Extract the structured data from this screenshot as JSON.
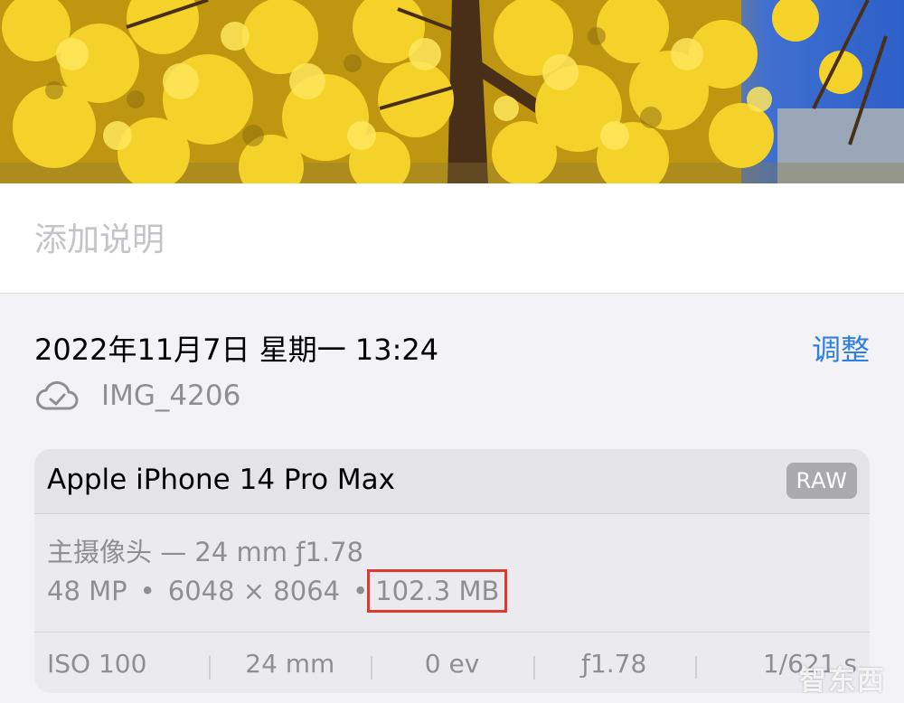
{
  "photo": {
    "subject": "yellow ginkgo tree against blue sky"
  },
  "caption": {
    "placeholder": "添加说明"
  },
  "info": {
    "date": "2022年11月7日 星期一 13:24",
    "adjust_label": "调整",
    "filename": "IMG_4206"
  },
  "camera": {
    "device": "Apple iPhone 14 Pro Max",
    "badge": "RAW",
    "lens": "主摄像头 — 24 mm ƒ1.78",
    "megapixels": "48 MP",
    "resolution": "6048 × 8064",
    "file_size": "102.3 MB",
    "separator": "•",
    "exif": {
      "iso": "ISO 100",
      "focal": "24 mm",
      "ev": "0 ev",
      "aperture": "ƒ1.78",
      "shutter": "1/621 s"
    }
  },
  "watermark": {
    "text": "智东西"
  },
  "colors": {
    "accent": "#2f7fe0",
    "highlight_box": "#e0392f",
    "secondary_text": "#8e8e93"
  }
}
